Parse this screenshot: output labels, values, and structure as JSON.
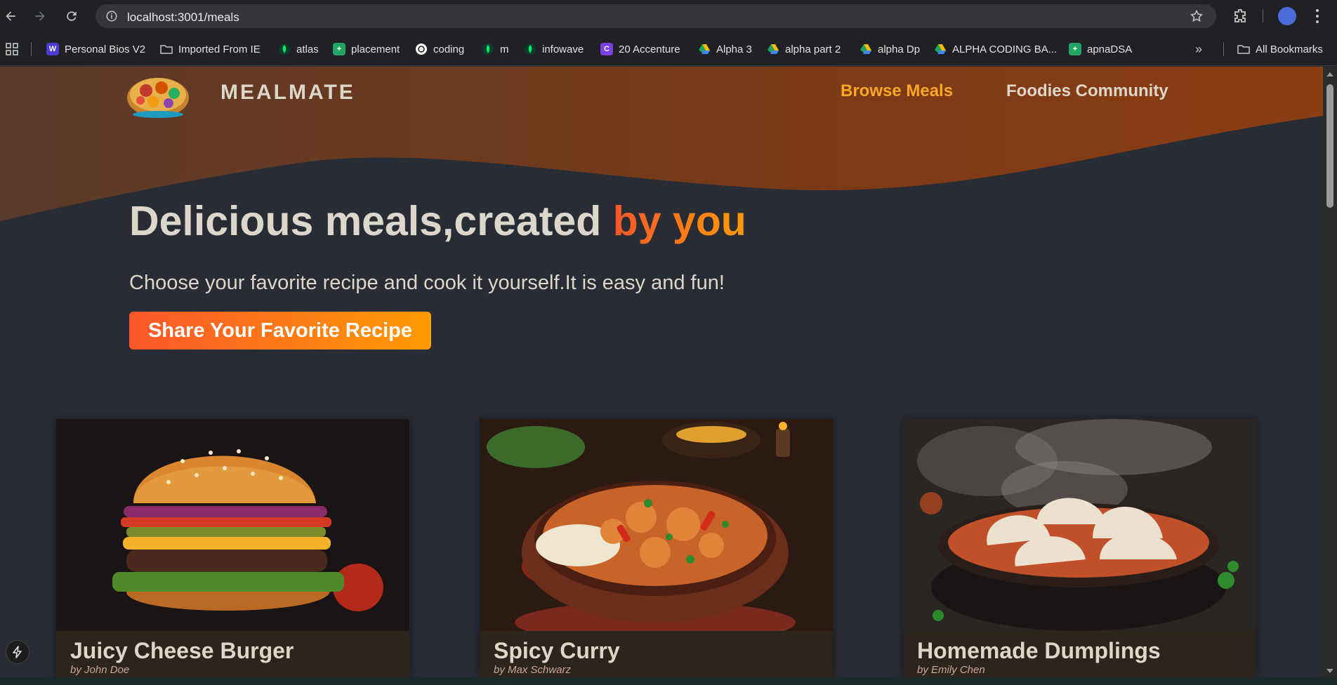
{
  "browser": {
    "url": "localhost:3001/meals",
    "bookmarks": [
      {
        "label": "Personal Bios V2",
        "icon": "ai-icon",
        "color": "#4b3bd9"
      },
      {
        "label": "Imported From IE",
        "icon": "folder-icon",
        "color": ""
      },
      {
        "label": "atlas",
        "icon": "mongodb-leaf-icon",
        "color": "#00ed64"
      },
      {
        "label": "placement",
        "icon": "sheets-icon",
        "color": "#23a566"
      },
      {
        "label": "coding",
        "icon": "chatgpt-icon",
        "color": "#ffffff"
      },
      {
        "label": "m",
        "icon": "mongodb-leaf-icon",
        "color": "#00ed64"
      },
      {
        "label": "infowave",
        "icon": "mongodb-leaf-icon",
        "color": "#00ed64"
      },
      {
        "label": "20 Accenture",
        "icon": "c-icon",
        "color": "#7b3fe4"
      },
      {
        "label": "Alpha 3",
        "icon": "drive-icon",
        "color": ""
      },
      {
        "label": "alpha part 2",
        "icon": "drive-icon",
        "color": ""
      },
      {
        "label": "alpha Dp",
        "icon": "drive-icon",
        "color": ""
      },
      {
        "label": "ALPHA CODING BA...",
        "icon": "drive-icon",
        "color": ""
      },
      {
        "label": "apnaDSA",
        "icon": "sheets-icon",
        "color": "#23a566"
      }
    ],
    "all_bookmarks": "All Bookmarks"
  },
  "header": {
    "logo_text": "MEALMATE",
    "nav": [
      {
        "label": "Browse Meals",
        "active": true
      },
      {
        "label": "Foodies Community",
        "active": false
      }
    ]
  },
  "hero": {
    "title_main": "Delicious meals,created ",
    "title_accent": "by you",
    "subtitle": "Choose your favorite recipe and cook it yourself.It is easy and fun!",
    "cta": "Share Your Favorite Recipe"
  },
  "meals": [
    {
      "title": "Juicy Cheese Burger",
      "creator": "by John Doe",
      "image": "burger-image"
    },
    {
      "title": "Spicy Curry",
      "creator": "by Max Schwarz",
      "image": "curry-image"
    },
    {
      "title": "Homemade Dumplings",
      "creator": "by Emily Chen",
      "image": "dumplings-image"
    }
  ],
  "colors": {
    "accent_start": "#f9572a",
    "accent_end": "#ff9b05",
    "active_nav": "#f9a825",
    "page_bg": "#282c34",
    "wave": "#8b3d14"
  }
}
